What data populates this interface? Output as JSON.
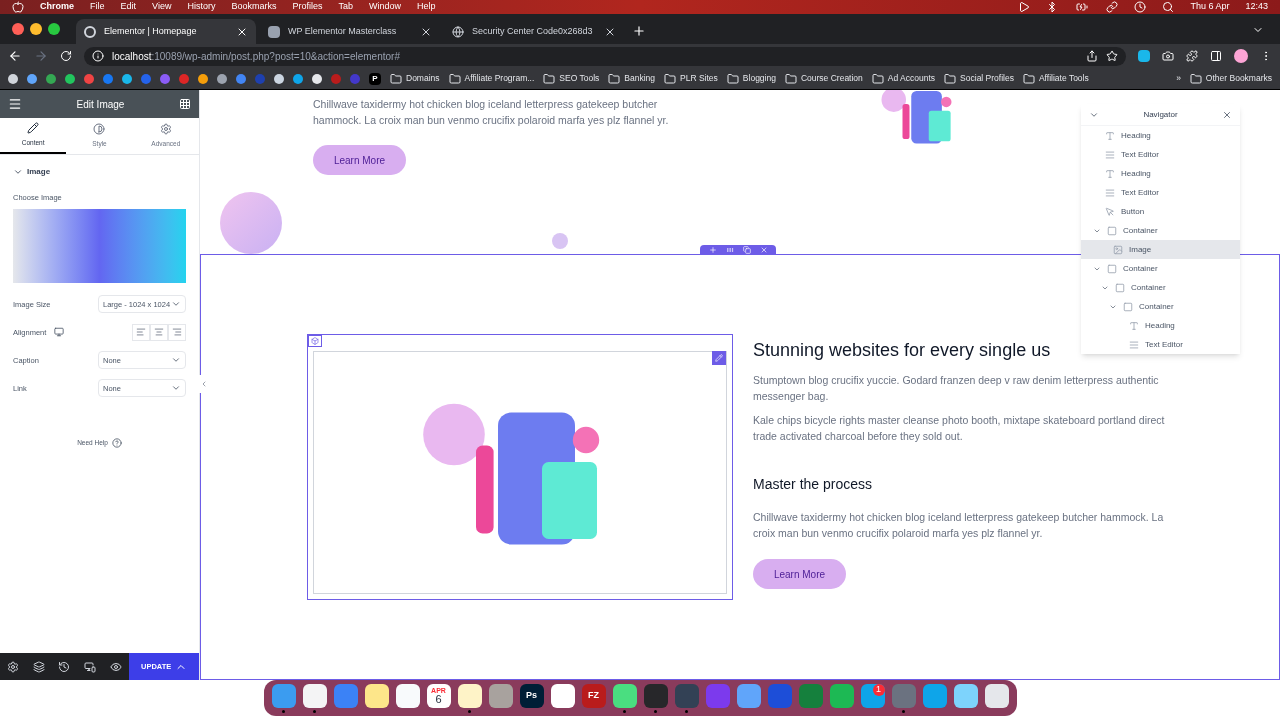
{
  "menu_bar": {
    "app": "Chrome",
    "menus": [
      "File",
      "Edit",
      "View",
      "History",
      "Bookmarks",
      "Profiles",
      "Tab",
      "Window",
      "Help"
    ],
    "date": "Thu 6 Apr",
    "time": "12:43"
  },
  "tabs": [
    {
      "title": "Elementor | Homepage",
      "kind": "wordpress",
      "selected": true
    },
    {
      "title": "WP Elementor Masterclass",
      "kind": "app",
      "selected": false
    },
    {
      "title": "Security Center Code0x268d3",
      "kind": "globe",
      "selected": false
    }
  ],
  "address": {
    "host": "localhost",
    "path": ":10089/wp-admin/post.php?post=10&action=elementor#"
  },
  "bookmarks": {
    "icons": [
      {
        "color": "#d1d5db"
      },
      {
        "color": "#60a5fa"
      },
      {
        "color": "#34a853"
      },
      {
        "color": "#22c55e"
      },
      {
        "color": "#ef4444"
      },
      {
        "color": "#1877f2"
      },
      {
        "color": "#1ab7ea"
      },
      {
        "color": "#2563eb"
      },
      {
        "color": "#8b5cf6"
      },
      {
        "color": "#dc2626"
      },
      {
        "color": "#f59e0b"
      },
      {
        "color": "#9ca3af"
      },
      {
        "color": "#4285f4"
      },
      {
        "color": "#1e40af"
      },
      {
        "color": "#cbd5e1"
      },
      {
        "color": "#0ea5e9"
      },
      {
        "color": "#e5e7eb"
      },
      {
        "color": "#b91c1c"
      },
      {
        "color": "#4338ca"
      }
    ],
    "letter_icon": "P",
    "folders": [
      "Domains",
      "Affiliate Program...",
      "SEO Tools",
      "Banking",
      "PLR Sites",
      "Blogging",
      "Course Creation",
      "Ad Accounts",
      "Social Profiles",
      "Affiliate Tools"
    ],
    "more": "»",
    "other": "Other Bookmarks"
  },
  "editor_panel": {
    "title": "Edit Image",
    "tabs": [
      {
        "label": "Content",
        "kind": "content",
        "selected": true
      },
      {
        "label": "Style",
        "kind": "style",
        "selected": false
      },
      {
        "label": "Advanced",
        "kind": "advanced",
        "selected": false
      }
    ],
    "section": {
      "title": "Image",
      "expanded": true
    },
    "choose_label": "Choose Image",
    "fields": [
      {
        "label": "Image Size",
        "kind": "select",
        "value": "Large - 1024 x 1024"
      },
      {
        "label": "Alignment",
        "kind": "alignment"
      },
      {
        "label": "Caption",
        "kind": "select",
        "value": "None"
      },
      {
        "label": "Link",
        "kind": "select",
        "value": "None"
      }
    ],
    "help": "Need Help",
    "update": "UPDATE"
  },
  "canvas": {
    "top": {
      "paragraph": "Chillwave taxidermy hot chicken blog iceland letterpress gatekeep butcher hammock. La croix man bun venmo crucifix polaroid marfa yes plz flannel yr.",
      "button": "Learn More"
    },
    "section": {
      "heading": "Stunning websites for every single us",
      "paragraphs": [
        "Stumptown blog crucifix yuccie. Godard franzen deep v raw denim letterpress authentic messenger bag.",
        "Kale chips bicycle rights master cleanse photo booth, mixtape skateboard portland direct trade activated charcoal before they sold out."
      ],
      "subheading": "Master the process",
      "paragraph": "Chillwave taxidermy hot chicken blog iceland letterpress gatekeep butcher hammock. La croix man bun venmo crucifix polaroid marfa yes plz flannel yr.",
      "button": "Learn More"
    }
  },
  "navigator": {
    "title": "Navigator",
    "tree": [
      {
        "label": "Heading",
        "kind": "heading",
        "selected": false
      },
      {
        "label": "Text Editor",
        "kind": "text",
        "selected": false
      },
      {
        "label": "Heading",
        "kind": "heading",
        "selected": false
      },
      {
        "label": "Text Editor",
        "kind": "text",
        "selected": false
      },
      {
        "label": "Button",
        "kind": "button",
        "selected": false
      },
      {
        "label": "Container",
        "kind": "container",
        "expanded": true,
        "selected": false,
        "children": [
          {
            "label": "Image",
            "kind": "image",
            "selected": true
          }
        ]
      },
      {
        "label": "Container",
        "kind": "container",
        "expanded": true,
        "selected": false,
        "children": [
          {
            "label": "Container",
            "kind": "container",
            "expanded": true,
            "selected": false,
            "children": [
              {
                "label": "Container",
                "kind": "container",
                "expanded": true,
                "selected": false,
                "children": [
                  {
                    "label": "Heading",
                    "kind": "heading",
                    "selected": false
                  },
                  {
                    "label": "Text Editor",
                    "kind": "text",
                    "selected": false
                  }
                ]
              }
            ]
          }
        ]
      }
    ]
  },
  "dock": [
    {
      "color": "#3b9cf0",
      "running": true
    },
    {
      "color": "#f4f4f5",
      "running": true
    },
    {
      "color": "#3b82f6",
      "running": false
    },
    {
      "color": "#fde68a",
      "running": false
    },
    {
      "color": "#f8fafc",
      "running": false
    },
    {
      "color": "#ffffff",
      "running": false,
      "kind": "calendar",
      "month": "APR",
      "day": "6"
    },
    {
      "color": "#fef3c7",
      "running": true
    },
    {
      "color": "#a8a29e",
      "running": false
    },
    {
      "color": "#001e36",
      "running": false,
      "kind": "letters",
      "label": "Ps"
    },
    {
      "color": "#ffffff",
      "running": false
    },
    {
      "color": "#b91c1c",
      "running": false,
      "kind": "letters",
      "label": "FZ"
    },
    {
      "color": "#4ade80",
      "running": true
    },
    {
      "color": "#27272a",
      "running": true
    },
    {
      "color": "#334155",
      "running": true
    },
    {
      "color": "#7c3aed",
      "running": false
    },
    {
      "color": "#60a5fa",
      "running": false
    },
    {
      "color": "#1d4ed8",
      "running": false
    },
    {
      "color": "#15803d",
      "running": false
    },
    {
      "color": "#1db954",
      "running": false
    },
    {
      "color": "#0ea5e9",
      "running": false,
      "badge": "1"
    },
    {
      "color": "#6b7280",
      "running": true
    },
    {
      "color": "#0ea5e9",
      "running": false
    },
    {
      "color": "#7dd3fc",
      "running": false
    },
    {
      "color": "#e5e7eb",
      "running": false
    }
  ]
}
